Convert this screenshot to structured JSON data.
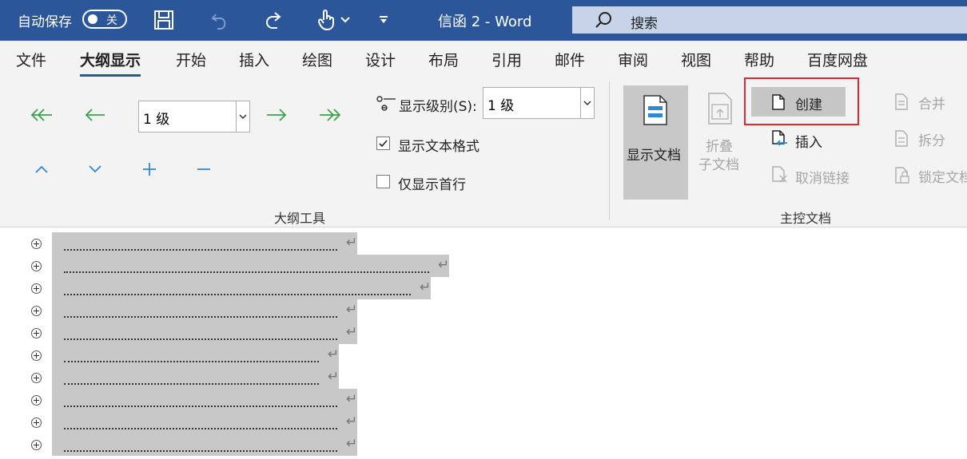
{
  "titlebar": {
    "autosave_label": "自动保存",
    "autosave_state": "关",
    "doc_title": "信函 2  -  Word",
    "search_placeholder": "搜索",
    "bg_color": "#2b579a"
  },
  "tabs": [
    "文件",
    "大纲显示",
    "开始",
    "插入",
    "绘图",
    "设计",
    "布局",
    "引用",
    "邮件",
    "审阅",
    "视图",
    "帮助",
    "百度网盘"
  ],
  "active_tab": "大纲显示",
  "outline_tools": {
    "level_value": "1 级",
    "show_level_label": "显示级别(S):",
    "show_level_value": "1 级",
    "show_text_format_label": "显示文本格式",
    "show_text_format_checked": true,
    "show_first_line_label": "仅显示首行",
    "show_first_line_checked": false,
    "group_label": "大纲工具"
  },
  "master_doc": {
    "show_doc_label": "显示文档",
    "collapse_label_line1": "折叠",
    "collapse_label_line2": "子文档",
    "create_label": "创建",
    "insert_label": "插入",
    "unlink_label": "取消链接",
    "merge_label": "合并",
    "split_label": "拆分",
    "lock_label": "锁定文档",
    "group_label": "主控文档"
  },
  "outline_row_count": 10
}
